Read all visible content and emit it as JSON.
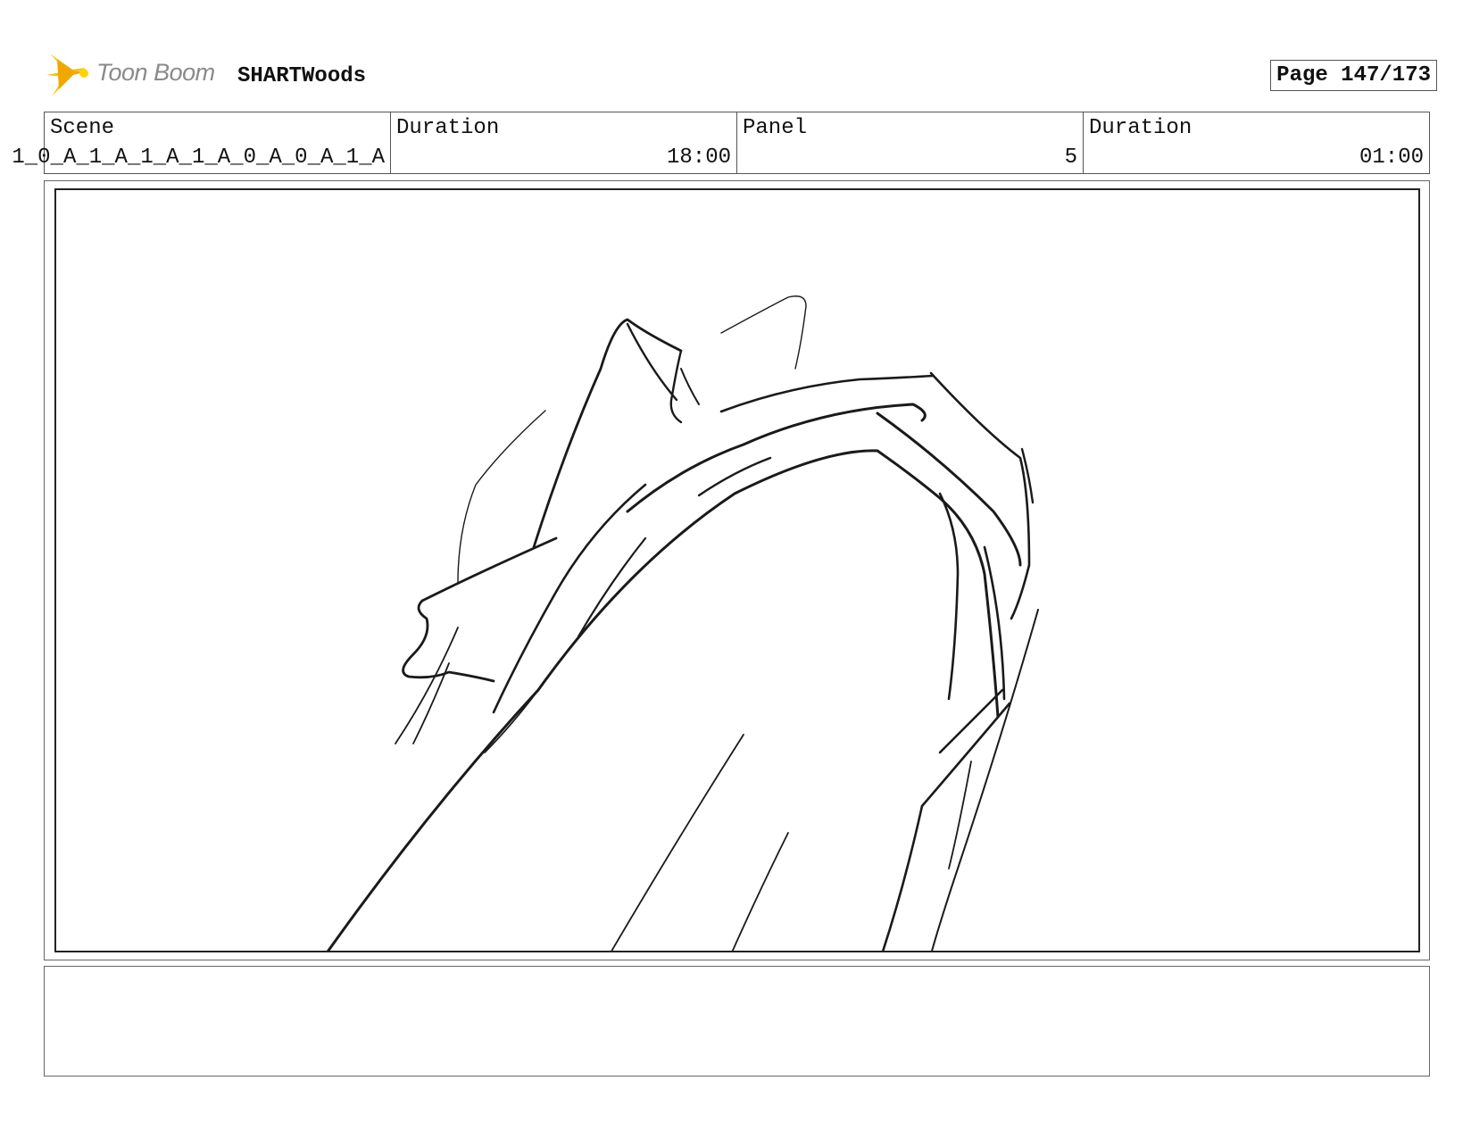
{
  "header": {
    "logo_text": "Toon Boom",
    "project_title": "SHARTWoods",
    "page_label": "Page 147/173"
  },
  "info": {
    "scene_label": "Scene",
    "scene_value": "1_0_A_1_A_1_A_1_A_0_A_0_A_1_A",
    "scene_duration_label": "Duration",
    "scene_duration_value": "18:00",
    "panel_label": "Panel",
    "panel_value": "5",
    "panel_duration_label": "Duration",
    "panel_duration_value": "01:00"
  },
  "notes": {
    "text": ""
  },
  "colors": {
    "logo_accent": "#f5c400",
    "logo_text": "#8a8a8a",
    "border": "#555555",
    "sketch": "#1a1a1a"
  }
}
